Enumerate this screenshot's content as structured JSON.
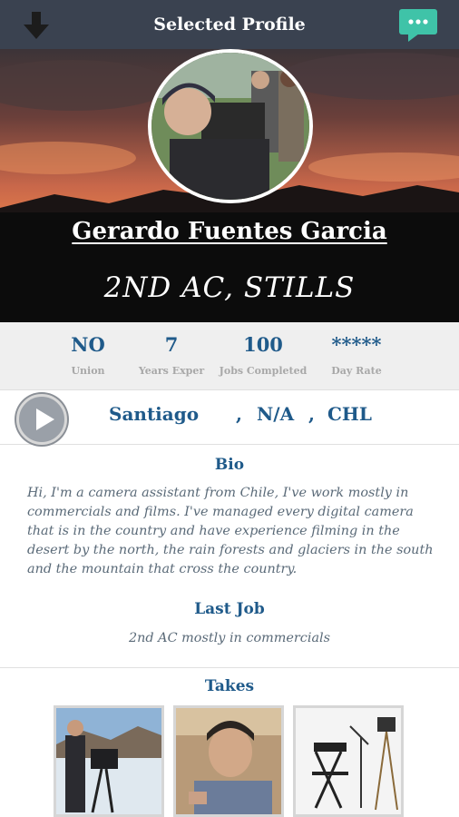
{
  "header": {
    "title": "Selected Profile",
    "back_icon": "arrow-down-icon",
    "chat_icon": "chat-bubble-icon",
    "chat_color": "#3fc3a8"
  },
  "profile": {
    "name": "Gerardo Fuentes Garcia",
    "role": "2ND AC, STILLS"
  },
  "stats": [
    {
      "value": "NO",
      "label": "Union"
    },
    {
      "value": "7",
      "label": "Years Exper"
    },
    {
      "value": "100",
      "label": "Jobs Completed"
    },
    {
      "value": "*****",
      "label": "Day Rate"
    }
  ],
  "location": {
    "city": "Santiago",
    "sep1": ",",
    "region": "N/A",
    "sep2": ",",
    "country": "CHL"
  },
  "bio": {
    "title": "Bio",
    "text": "Hi, I'm a camera assistant from Chile, I've work mostly in commercials and films. I've managed every digital camera that is in the country and have experience filming in the desert by the north, the rain forests and glaciers in the south and the mountain that cross the country."
  },
  "last_job": {
    "title": "Last Job",
    "text": "2nd AC mostly in commercials"
  },
  "takes": {
    "title": "Takes"
  },
  "colors": {
    "topbar": "#3a4250",
    "accent": "#1f5a8a",
    "stats_bg": "#efefef"
  }
}
